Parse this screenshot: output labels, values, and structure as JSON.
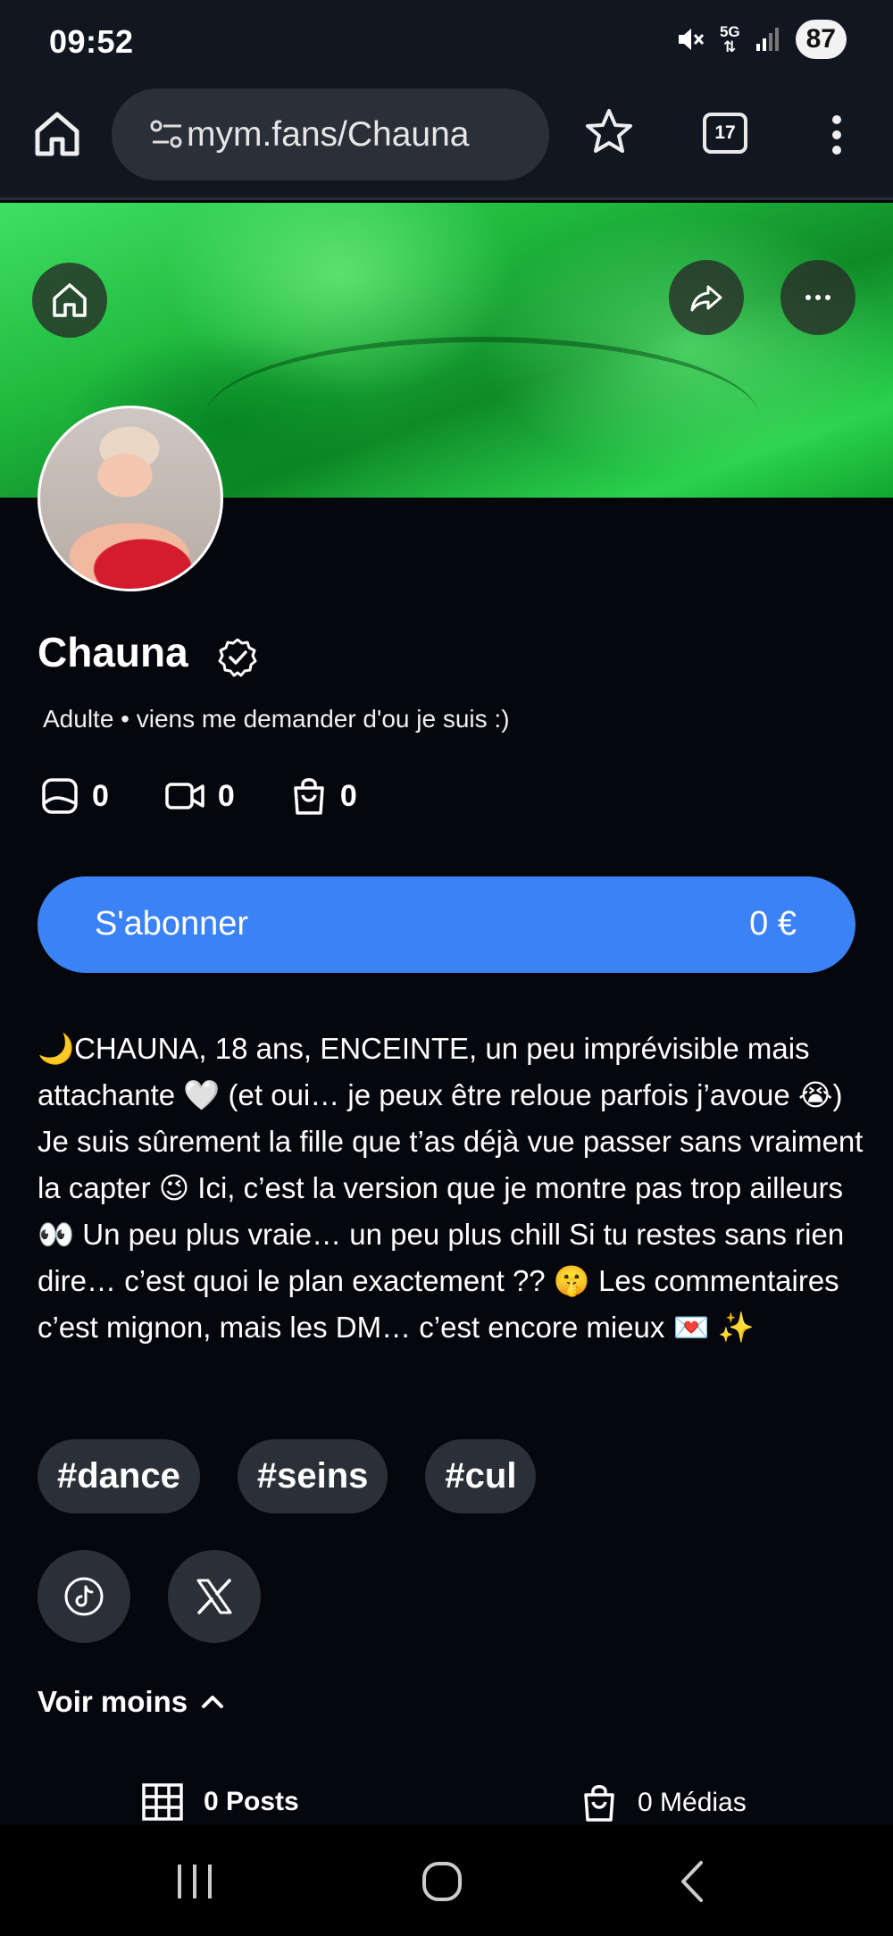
{
  "status_bar": {
    "time": "09:52",
    "network": "5G",
    "battery": "87"
  },
  "browser": {
    "url": "mym.fans/Chauna",
    "tab_count": "17"
  },
  "profile": {
    "name": "Chauna",
    "subtitle": "Adulte • viens me demander d'ou je suis :)",
    "stats": [
      {
        "icon": "photo-icon",
        "value": "0"
      },
      {
        "icon": "video-icon",
        "value": "0"
      },
      {
        "icon": "bag-icon",
        "value": "0"
      }
    ]
  },
  "subscribe": {
    "label": "S'abonner",
    "price": "0 €",
    "color": "#3b82f6"
  },
  "bio": "🌙CHAUNA, 18 ans, ENCEINTE, un peu imprévisible mais attachante 🤍 (et oui… je peux être reloue parfois j’avoue 😭) Je suis sûrement la fille que t’as déjà vue passer sans vraiment la capter 😉 Ici, c’est la version que je montre pas trop ailleurs 👀 Un peu plus vraie… un peu plus chill Si tu restes sans rien dire… c’est quoi le plan exactement ?? 🤫 Les commentaires c’est mignon, mais les DM… c’est encore mieux 💌 ✨",
  "tags": [
    "#dance",
    "#seins",
    "#cul"
  ],
  "social": [
    "tiktok-icon",
    "x-icon"
  ],
  "toggle": {
    "label": "Voir moins"
  },
  "tabs": [
    {
      "icon": "grid-icon",
      "label": "0 Posts"
    },
    {
      "icon": "bag-icon",
      "label": "0 Médias"
    }
  ]
}
